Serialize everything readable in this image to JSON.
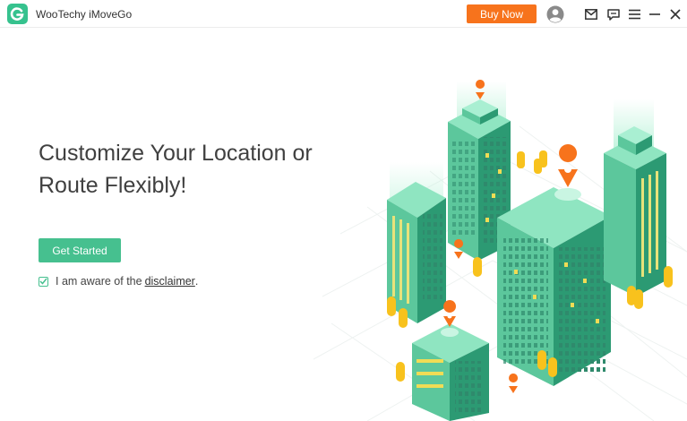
{
  "window": {
    "title": "WooTechy iMoveGo",
    "buy_label": "Buy Now",
    "accent_color": "#f7731c",
    "brand_color": "#36c28e",
    "icons": [
      "user-avatar-icon",
      "mail-icon",
      "feedback-icon",
      "menu-icon",
      "minimize-icon",
      "close-icon"
    ]
  },
  "main": {
    "headline_line1": "Customize Your Location or",
    "headline_line2": "Route Flexibly!",
    "get_started_label": "Get Started",
    "agree_text": "I am aware of the",
    "disclaimer_link": "disclaimer",
    "agree_period": ".",
    "agree_checked": true,
    "primary_color": "#46c08f"
  }
}
